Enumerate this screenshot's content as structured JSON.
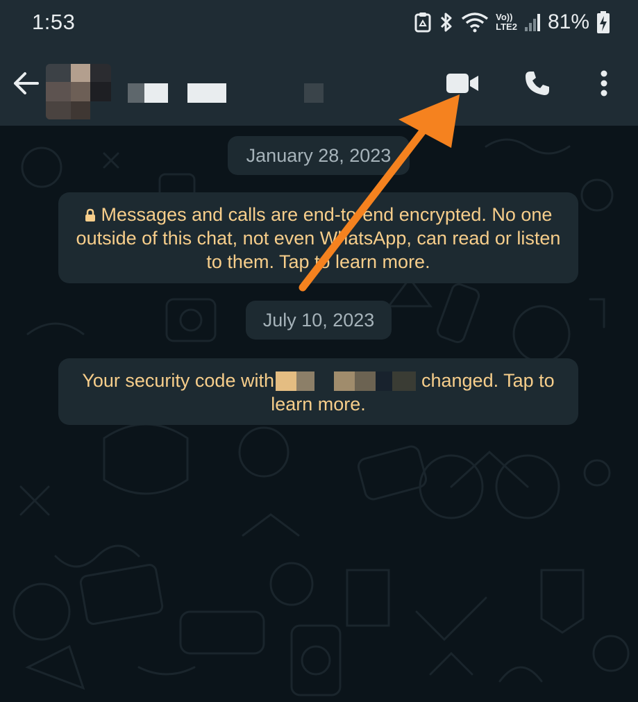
{
  "status_bar": {
    "time": "1:53",
    "network_badge_top": "Vo))",
    "network_badge_bottom": "LTE2",
    "battery_percent": "81%"
  },
  "header": {
    "back_icon": "arrow-left-icon",
    "avatar": "contact-avatar-pixelated",
    "contact_name_redacted": true,
    "actions": [
      {
        "name": "video-call",
        "icon": "video-camera-icon"
      },
      {
        "name": "voice-call",
        "icon": "phone-icon"
      },
      {
        "name": "more-options",
        "icon": "more-vertical-icon"
      }
    ]
  },
  "chat": {
    "date_1": "January 28, 2023",
    "encryption_notice": "Messages and calls are end-to-end encrypted. No one outside of this chat, not even WhatsApp, can read or listen to them. Tap to learn more.",
    "date_2": "July 10, 2023",
    "security_notice_prefix": "Your security code with",
    "security_notice_suffix": "changed. Tap to learn more."
  },
  "colors": {
    "bar_bg": "#1f2c34",
    "chat_bg": "#0b141a",
    "bubble_bg": "#1d2a31",
    "system_text": "#f7ce8b",
    "date_text": "#a6b3ba",
    "annotation_arrow": "#f5821f"
  }
}
